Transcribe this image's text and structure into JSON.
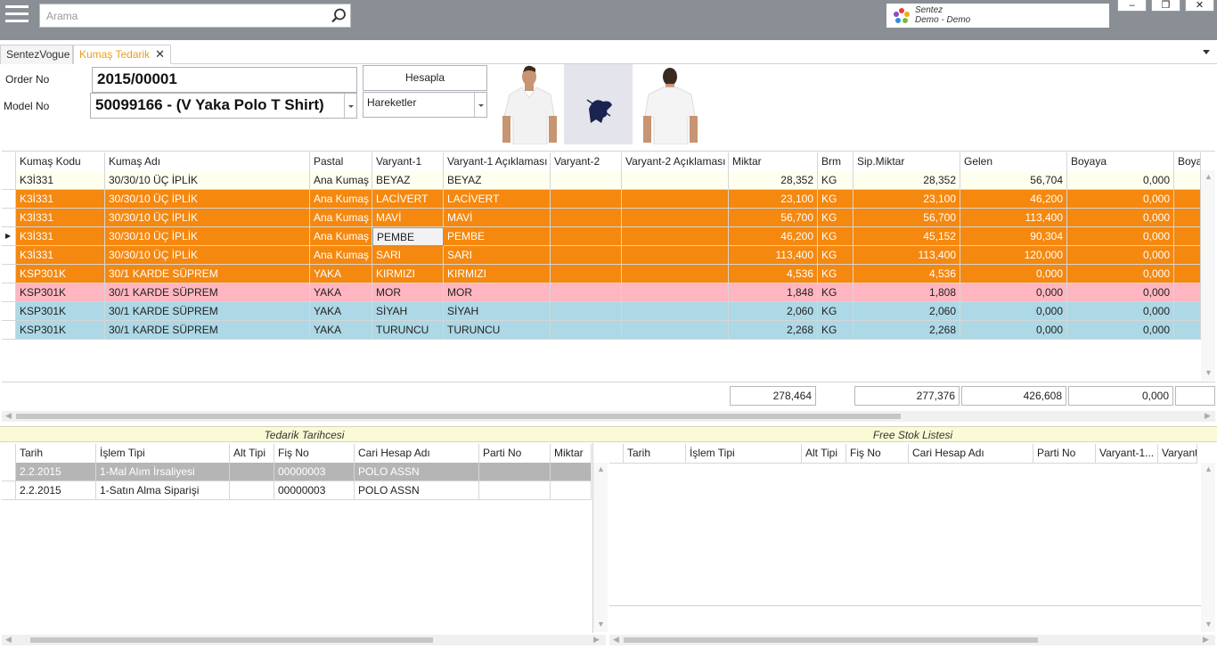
{
  "topbar": {
    "search_placeholder": "Arama",
    "company_line1": "Sentez",
    "company_line2": "Demo - Demo",
    "win_minimize": "–",
    "win_restore": "❐",
    "win_close": "✕"
  },
  "tabs": [
    {
      "label": "SentezVogue"
    },
    {
      "label": "Kumaş Tedarik",
      "active": true
    }
  ],
  "form": {
    "order_no_label": "Order No",
    "order_no_value": "2015/00001",
    "model_no_label": "Model No",
    "model_no_value": "50099166 - (V Yaka Polo T Shirt)",
    "hesapla_label": "Hesapla",
    "hareketler_value": "Hareketler"
  },
  "main_grid": {
    "columns": [
      "Kumaş Kodu",
      "Kumaş Adı",
      "Pastal",
      "Varyant-1",
      "Varyant-1 Açıklaması",
      "Varyant-2",
      "Varyant-2 Açıklaması",
      "Miktar",
      "Brm",
      "Sip.Miktar",
      "Gelen",
      "Boyaya",
      "Boya"
    ],
    "rows": [
      {
        "bg": "#fffff0",
        "fg": "#222222",
        "cells": [
          "K3İ331",
          "30/30/10 ÜÇ İPLİK",
          "Ana Kumaş",
          "BEYAZ",
          "BEYAZ",
          "",
          "",
          "28,352",
          "KG",
          "28,352",
          "56,704",
          "0,000",
          ""
        ]
      },
      {
        "bg": "#f5880f",
        "fg": "#ffffff",
        "cells": [
          "K3İ331",
          "30/30/10 ÜÇ İPLİK",
          "Ana Kumaş",
          "LACİVERT",
          "LACİVERT",
          "",
          "",
          "23,100",
          "KG",
          "23,100",
          "46,200",
          "0,000",
          ""
        ]
      },
      {
        "bg": "#f5880f",
        "fg": "#ffffff",
        "cells": [
          "K3İ331",
          "30/30/10 ÜÇ İPLİK",
          "Ana Kumaş",
          "MAVİ",
          "MAVİ",
          "",
          "",
          "56,700",
          "KG",
          "56,700",
          "113,400",
          "0,000",
          ""
        ]
      },
      {
        "bg": "#f5880f",
        "fg": "#ffffff",
        "selected": true,
        "cells": [
          "K3İ331",
          "30/30/10 ÜÇ İPLİK",
          "Ana Kumaş",
          "PEMBE",
          "PEMBE",
          "",
          "",
          "46,200",
          "KG",
          "45,152",
          "90,304",
          "0,000",
          ""
        ]
      },
      {
        "bg": "#f5880f",
        "fg": "#ffffff",
        "cells": [
          "K3İ331",
          "30/30/10 ÜÇ İPLİK",
          "Ana Kumaş",
          "SARI",
          "SARI",
          "",
          "",
          "113,400",
          "KG",
          "113,400",
          "120,000",
          "0,000",
          ""
        ]
      },
      {
        "bg": "#f5880f",
        "fg": "#ffffff",
        "cells": [
          "KSP301K",
          "30/1 KARDE SÜPREM",
          "YAKA",
          "KIRMIZI",
          "KIRMIZI",
          "",
          "",
          "4,536",
          "KG",
          "4,536",
          "0,000",
          "0,000",
          ""
        ]
      },
      {
        "bg": "#ffb6c1",
        "fg": "#222222",
        "cells": [
          "KSP301K",
          "30/1 KARDE SÜPREM",
          "YAKA",
          "MOR",
          "MOR",
          "",
          "",
          "1,848",
          "KG",
          "1,808",
          "0,000",
          "0,000",
          ""
        ]
      },
      {
        "bg": "#add8e6",
        "fg": "#222222",
        "cells": [
          "KSP301K",
          "30/1 KARDE SÜPREM",
          "YAKA",
          "SİYAH",
          "SİYAH",
          "",
          "",
          "2,060",
          "KG",
          "2,060",
          "0,000",
          "0,000",
          ""
        ]
      },
      {
        "bg": "#add8e6",
        "fg": "#222222",
        "cells": [
          "KSP301K",
          "30/1 KARDE SÜPREM",
          "YAKA",
          "TURUNCU",
          "TURUNCU",
          "",
          "",
          "2,268",
          "KG",
          "2,268",
          "0,000",
          "0,000",
          ""
        ]
      }
    ],
    "totals": {
      "miktar": "278,464",
      "sip_miktar": "277,376",
      "gelen": "426,608",
      "boyaya": "0,000"
    }
  },
  "tedarik": {
    "title": "Tedarik Tarihcesi",
    "columns": [
      "Tarih",
      "İşlem Tipi",
      "Alt Tipi",
      "Fiş No",
      "Cari Hesap Adı",
      "Parti No",
      "Miktar"
    ],
    "rows": [
      {
        "selected": true,
        "cells": [
          "2.2.2015",
          "1-Mal Alım İrsaliyesi",
          "",
          "00000003",
          "POLO ASSN",
          "",
          ""
        ]
      },
      {
        "selected": false,
        "cells": [
          "2.2.2015",
          "1-Satın Alma Siparişi",
          "",
          "00000003",
          "POLO ASSN",
          "",
          ""
        ]
      }
    ]
  },
  "freestok": {
    "title": "Free Stok Listesi",
    "columns": [
      "Tarih",
      "İşlem Tipi",
      "Alt Tipi",
      "Fiş No",
      "Cari Hesap Adı",
      "Parti No",
      "Varyant-1...",
      "Varyant-"
    ]
  },
  "colors": {
    "orange": "#f5880f",
    "pink": "#ffb6c1",
    "lightblue": "#add8e6",
    "active_tab": "#e8a020",
    "topbar": "#8a8f96"
  }
}
